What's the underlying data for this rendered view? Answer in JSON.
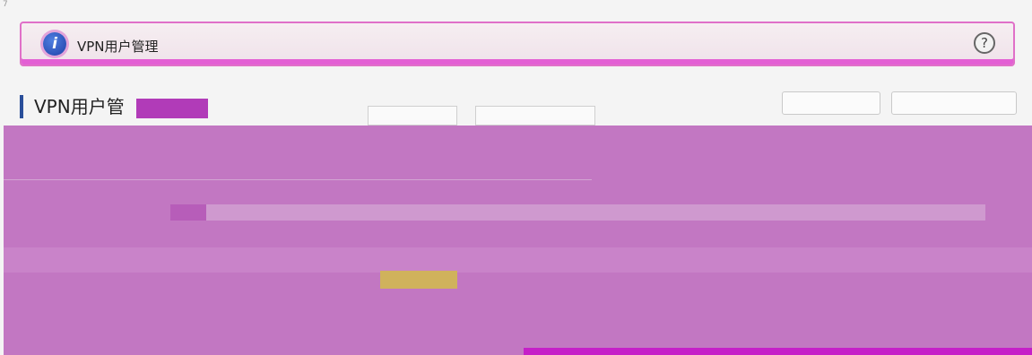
{
  "corner_mark": "7",
  "info_bar": {
    "title": "VPN用户管理",
    "info_icon_glyph": "i",
    "help_icon_glyph": "?"
  },
  "section": {
    "title": "VPN用户管"
  },
  "colors": {
    "accent": "#2a4f9a",
    "panel": "#c277c2",
    "highlight": "#d0b25c",
    "bar": "#c51fc8"
  }
}
